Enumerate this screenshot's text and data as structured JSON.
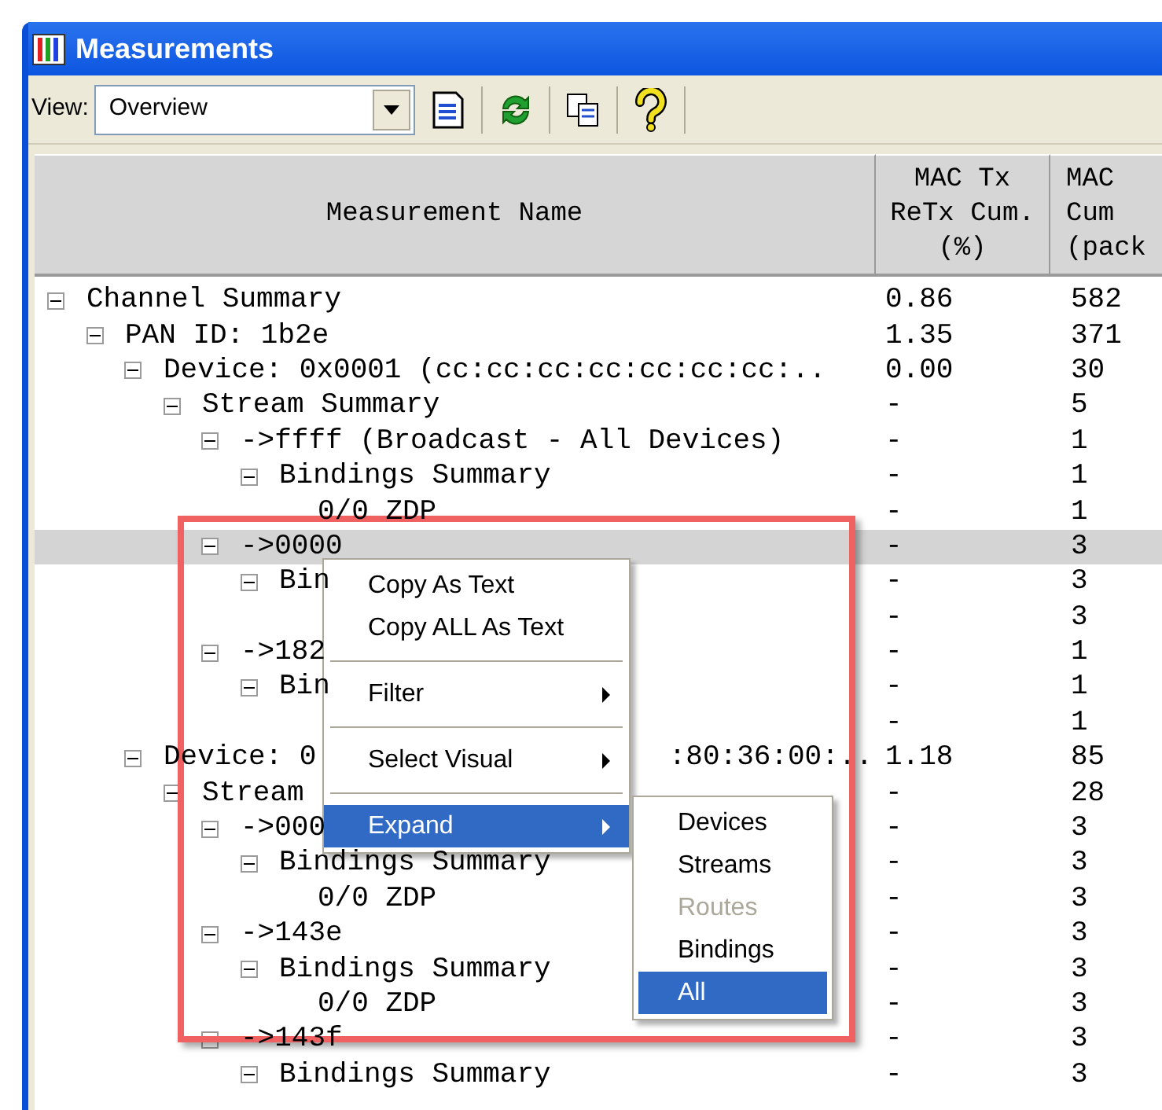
{
  "window": {
    "title": "Measurements"
  },
  "toolbar": {
    "view_label": "View:",
    "view_value": "Overview"
  },
  "table": {
    "columns": [
      "Measurement Name",
      "MAC Tx\nReTx Cum.\n(%)",
      "MAC\nCum\n(pack"
    ],
    "tree": [
      {
        "name": "Channel Summary",
        "values": [
          "0.86",
          "582"
        ],
        "expanded": true,
        "selected": false,
        "children": [
          {
            "name": "PAN ID: 1b2e",
            "values": [
              "1.35",
              "371"
            ],
            "expanded": true,
            "selected": false,
            "children": [
              {
                "name": "Device: 0x0001 (cc:cc:cc:cc:cc:cc:cc:..",
                "values": [
                  "0.00",
                  "30"
                ],
                "expanded": true,
                "selected": false,
                "children": [
                  {
                    "name": "Stream Summary",
                    "values": [
                      "-",
                      "5"
                    ],
                    "expanded": true,
                    "selected": false,
                    "children": [
                      {
                        "name": "->ffff (Broadcast - All Devices)",
                        "values": [
                          "-",
                          "1"
                        ],
                        "expanded": true,
                        "selected": false,
                        "children": [
                          {
                            "name": "Bindings Summary",
                            "values": [
                              "-",
                              "1"
                            ],
                            "expanded": true,
                            "selected": false,
                            "children": [
                              {
                                "name": "0/0 ZDP",
                                "values": [
                                  "-",
                                  "1"
                                ],
                                "selected": false
                              }
                            ]
                          }
                        ]
                      },
                      {
                        "name": "->0000",
                        "values": [
                          "-",
                          "3"
                        ],
                        "expanded": true,
                        "selected": true,
                        "children": [
                          {
                            "name": "Bin",
                            "values": [
                              "-",
                              "3"
                            ],
                            "expanded": true,
                            "selected": false,
                            "children": [
                              {
                                "values": [
                                  "-",
                                  "3"
                                ],
                                "selected": false
                              }
                            ]
                          }
                        ]
                      },
                      {
                        "name": "->182",
                        "values": [
                          "-",
                          "1"
                        ],
                        "expanded": true,
                        "selected": false,
                        "children": [
                          {
                            "name": "Bin",
                            "values": [
                              "-",
                              "1"
                            ],
                            "expanded": true,
                            "selected": false,
                            "children": [
                              {
                                "values": [
                                  "-",
                                  "1"
                                ],
                                "selected": false
                              }
                            ]
                          }
                        ]
                      }
                    ]
                  }
                ]
              },
              {
                "name": "Device: 0",
                "name_tail": ":80:36:00:..",
                "values": [
                  "1.18",
                  "85"
                ],
                "expanded": true,
                "selected": false,
                "children": [
                  {
                    "name": "Stream",
                    "values": [
                      "-",
                      "28"
                    ],
                    "expanded": true,
                    "selected": false,
                    "children": [
                      {
                        "name": "->000",
                        "values": [
                          "-",
                          "3"
                        ],
                        "expanded": true,
                        "selected": false,
                        "children": [
                          {
                            "name": "Bindings Summary",
                            "values": [
                              "-",
                              "3"
                            ],
                            "expanded": true,
                            "selected": false,
                            "children": [
                              {
                                "name": "0/0 ZDP",
                                "values": [
                                  "-",
                                  "3"
                                ],
                                "selected": false
                              }
                            ]
                          }
                        ]
                      },
                      {
                        "name": "->143e",
                        "values": [
                          "-",
                          "3"
                        ],
                        "expanded": true,
                        "selected": false,
                        "children": [
                          {
                            "name": "Bindings Summary",
                            "values": [
                              "-",
                              "3"
                            ],
                            "expanded": true,
                            "selected": false,
                            "children": [
                              {
                                "name": "0/0 ZDP",
                                "values": [
                                  "-",
                                  "3"
                                ],
                                "selected": false
                              }
                            ]
                          }
                        ]
                      },
                      {
                        "name": "->143f",
                        "values": [
                          "-",
                          "3"
                        ],
                        "expanded": true,
                        "selected": false,
                        "children": [
                          {
                            "name": "Bindings Summary",
                            "values": [
                              "-",
                              "3"
                            ],
                            "expanded": true,
                            "selected": false
                          }
                        ]
                      }
                    ]
                  }
                ]
              }
            ]
          }
        ]
      }
    ]
  },
  "context_menu": {
    "items": [
      {
        "kind": "item",
        "label": "Copy As Text",
        "submenu": false,
        "selected": false
      },
      {
        "kind": "item",
        "label": "Copy ALL As Text",
        "submenu": false,
        "selected": false
      },
      {
        "kind": "separator"
      },
      {
        "kind": "item",
        "label": "Filter",
        "submenu": true,
        "selected": false
      },
      {
        "kind": "separator"
      },
      {
        "kind": "item",
        "label": "Select Visual",
        "submenu": true,
        "selected": false
      },
      {
        "kind": "separator"
      },
      {
        "kind": "item",
        "label": "Expand",
        "submenu": true,
        "selected": true
      }
    ]
  },
  "submenu": {
    "items": [
      {
        "label": "Devices",
        "disabled": false,
        "selected": false
      },
      {
        "label": "Streams",
        "disabled": false,
        "selected": false
      },
      {
        "label": "Routes",
        "disabled": true,
        "selected": false
      },
      {
        "label": "Bindings",
        "disabled": false,
        "selected": false
      },
      {
        "label": "All",
        "disabled": false,
        "selected": true
      }
    ]
  }
}
